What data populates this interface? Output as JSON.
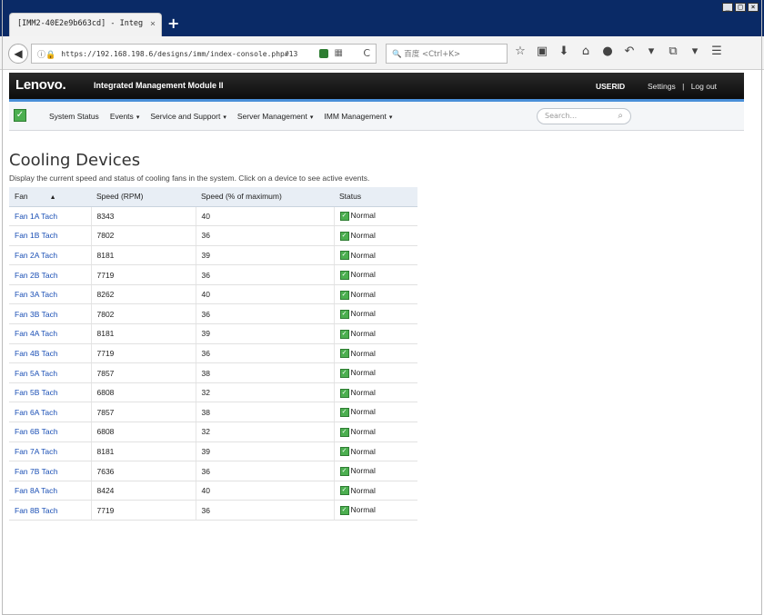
{
  "browser": {
    "tab_title": "[IMM2-40E2e9b663cd] - Integ",
    "url": "https://192.168.198.6/designs/imm/index-console.php#13",
    "search_placeholder": "百度 <Ctrl+K>",
    "new_tab": "+",
    "tab_close": "×"
  },
  "header": {
    "brand": "Lenovo.",
    "product": "Integrated Management Module II",
    "user": "USERID",
    "settings": "Settings",
    "separator": "|",
    "logout": "Log out"
  },
  "menu": {
    "items": [
      {
        "label": "System Status"
      },
      {
        "label": "Events"
      },
      {
        "label": "Service and Support"
      },
      {
        "label": "Server Management"
      },
      {
        "label": "IMM Management"
      }
    ],
    "search_placeholder": "Search..."
  },
  "page": {
    "title": "Cooling Devices",
    "description": "Display the current speed and status of cooling fans in the system. Click on a device to see active events."
  },
  "table": {
    "columns": [
      "Fan",
      "Speed (RPM)",
      "Speed (% of maximum)",
      "Status"
    ],
    "rows": [
      {
        "fan": "Fan 1A Tach",
        "rpm": "8343",
        "pct": "40",
        "status": "Normal"
      },
      {
        "fan": "Fan 1B Tach",
        "rpm": "7802",
        "pct": "36",
        "status": "Normal"
      },
      {
        "fan": "Fan 2A Tach",
        "rpm": "8181",
        "pct": "39",
        "status": "Normal"
      },
      {
        "fan": "Fan 2B Tach",
        "rpm": "7719",
        "pct": "36",
        "status": "Normal"
      },
      {
        "fan": "Fan 3A Tach",
        "rpm": "8262",
        "pct": "40",
        "status": "Normal"
      },
      {
        "fan": "Fan 3B Tach",
        "rpm": "7802",
        "pct": "36",
        "status": "Normal"
      },
      {
        "fan": "Fan 4A Tach",
        "rpm": "8181",
        "pct": "39",
        "status": "Normal"
      },
      {
        "fan": "Fan 4B Tach",
        "rpm": "7719",
        "pct": "36",
        "status": "Normal"
      },
      {
        "fan": "Fan 5A Tach",
        "rpm": "7857",
        "pct": "38",
        "status": "Normal"
      },
      {
        "fan": "Fan 5B Tach",
        "rpm": "6808",
        "pct": "32",
        "status": "Normal"
      },
      {
        "fan": "Fan 6A Tach",
        "rpm": "7857",
        "pct": "38",
        "status": "Normal"
      },
      {
        "fan": "Fan 6B Tach",
        "rpm": "6808",
        "pct": "32",
        "status": "Normal"
      },
      {
        "fan": "Fan 7A Tach",
        "rpm": "8181",
        "pct": "39",
        "status": "Normal"
      },
      {
        "fan": "Fan 7B Tach",
        "rpm": "7636",
        "pct": "36",
        "status": "Normal"
      },
      {
        "fan": "Fan 8A Tach",
        "rpm": "8424",
        "pct": "40",
        "status": "Normal"
      },
      {
        "fan": "Fan 8B Tach",
        "rpm": "7719",
        "pct": "36",
        "status": "Normal"
      }
    ]
  }
}
